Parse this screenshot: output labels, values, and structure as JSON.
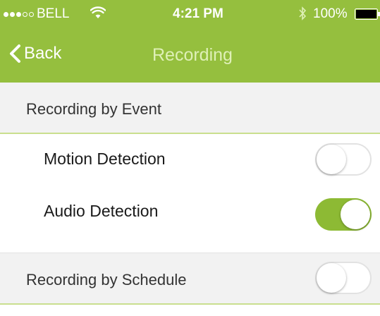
{
  "status_bar": {
    "carrier": "BELL",
    "signal_icon": "signal-dots-icon",
    "signal_filled": 3,
    "signal_total": 5,
    "wifi_icon": "wifi-icon",
    "time": "4:21 PM",
    "bluetooth_icon": "bluetooth-icon",
    "battery_percent": "100%",
    "battery_icon": "battery-icon",
    "battery_level": 1.0
  },
  "nav": {
    "back_icon": "chevron-left-icon",
    "back_label": "Back",
    "title": "Recording"
  },
  "sections": {
    "event": {
      "label": "Recording by Event",
      "rows": [
        {
          "label": "Motion Detection",
          "enabled": false
        },
        {
          "label": "Audio Detection",
          "enabled": true
        }
      ]
    },
    "schedule": {
      "label": "Recording by Schedule",
      "enabled": false
    }
  },
  "colors": {
    "header": "#95bf3e",
    "toggle_on": "#8dba34",
    "accent_line": "#c9df8e",
    "section_bg": "#f2f2f2"
  }
}
